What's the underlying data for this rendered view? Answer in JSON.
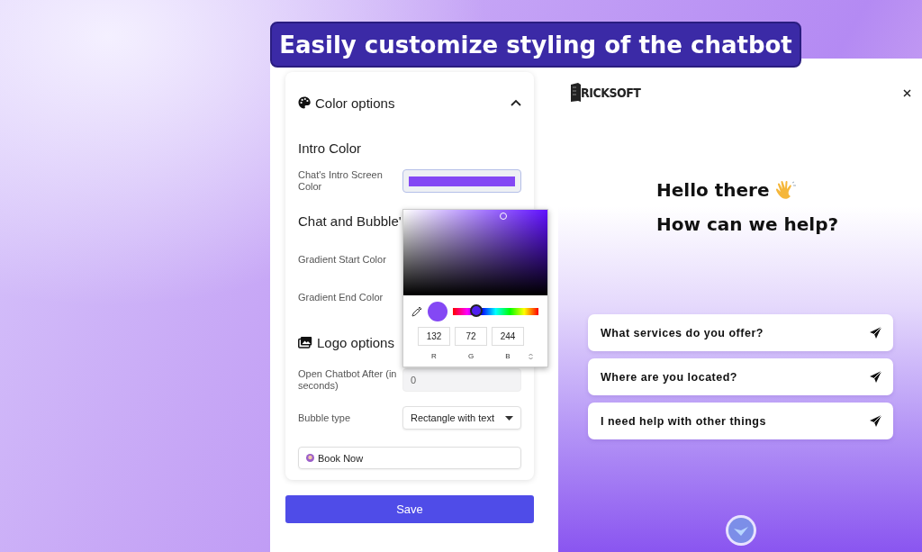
{
  "banner": {
    "title": "Easily customize styling of the chatbot"
  },
  "color_options": {
    "title": "Color options",
    "expanded": true,
    "intro_heading": "Intro Color",
    "intro_field_label": "Chat's Intro Screen Color",
    "bubble_heading": "Chat and Bubble'",
    "gradient_start_label": "Gradient Start Color",
    "gradient_end_label": "Gradient End Color"
  },
  "color_picker": {
    "level": 0.27,
    "r": "132",
    "g": "72",
    "b": "244",
    "r_label": "R",
    "g_label": "G",
    "b_label": "B"
  },
  "logo_options": {
    "title": "Logo options"
  },
  "fields": [
    {
      "kind": "input",
      "label": "Open Chatbot After (in seconds)",
      "value": "0",
      "disabled": true
    },
    {
      "kind": "select",
      "label": "Bubble type",
      "value": "Rectangle with text"
    },
    {
      "kind": "text",
      "value": "Book Now"
    }
  ],
  "save_button": "Save",
  "chat": {
    "logo": "RICKSOFT",
    "greeting": [
      "Hello there",
      "How can we help?"
    ],
    "questions": [
      {
        "text": "What services do you offer?"
      },
      {
        "text": "Where are you located?"
      },
      {
        "text": "I need help with other things"
      }
    ]
  }
}
